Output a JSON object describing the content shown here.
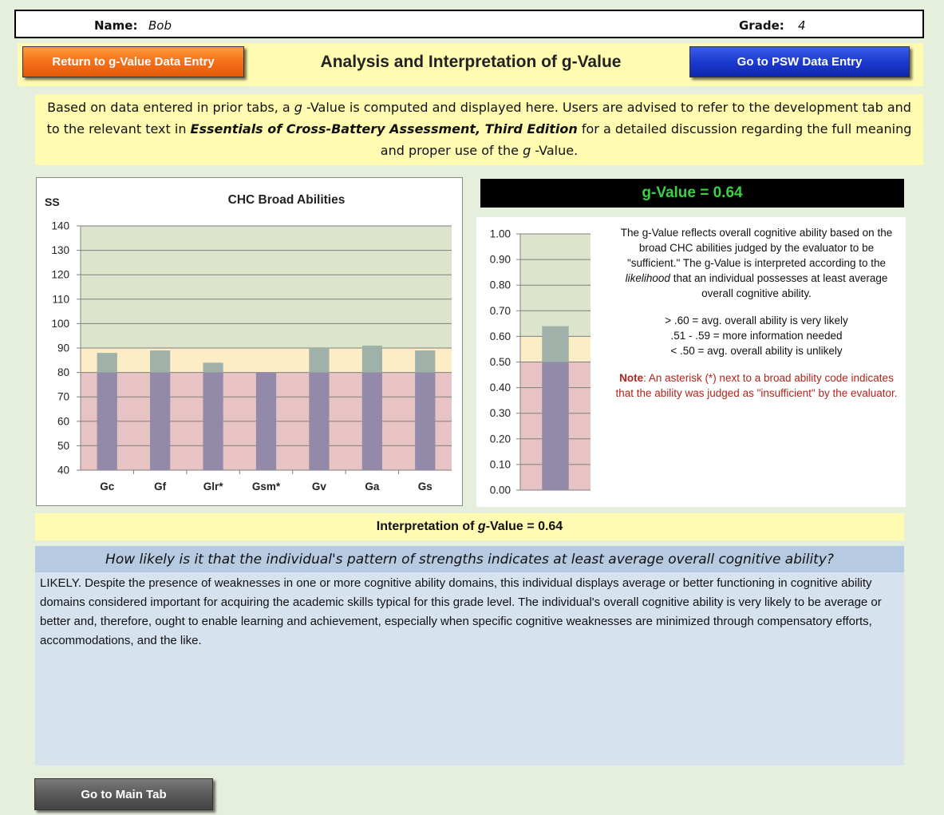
{
  "header": {
    "name_label": "Name:",
    "name_value": "Bob",
    "grade_label": "Grade:",
    "grade_value": "4"
  },
  "nav": {
    "return_button": "Return to g-Value Data Entry",
    "title": "Analysis and Interpretation of g-Value",
    "psw_button": "Go to PSW Data Entry",
    "main_button": "Go to Main Tab"
  },
  "intro": {
    "part1": "Based on data entered in prior tabs, a ",
    "g": "g",
    "part2": " -Value is computed and displayed here. Users are advised to refer to the development tab and to the relevant text in ",
    "book": "Essentials of Cross-Battery Assessment, Third Edition",
    "part3": " for a detailed discussion regarding the full meaning and proper use of the ",
    "part4": " -Value."
  },
  "gvalue": {
    "header": "g-Value = 0.64",
    "desc1": "The g-Value reflects overall cognitive ability based on the broad CHC abilities judged by the evaluator to be \"sufficient.\" The g-Value is interpreted according to the ",
    "desc_em": "likelihood",
    "desc2": " that an individual possesses at least average overall cognitive ability.",
    "rule1": "> .60 = avg. overall ability is very likely",
    "rule2": ".51 - .59 = more information needed",
    "rule3": "< .50 = avg. overall ability is unlikely",
    "note_label": "Note",
    "note_text": ": An asterisk (*) next to a broad ability code indicates that the ability was judged as \"insufficient\" by the evaluator."
  },
  "interpretation": {
    "label_pre": "Interpretation of ",
    "label_g": "g",
    "label_post": " -Value = ",
    "value": "0.64",
    "question": "How likely is it that the individual's pattern of strengths indicates at least average overall cognitive ability?",
    "result": "LIKELY. Despite the presence of weaknesses in one or more cognitive ability domains, this individual displays average or better functioning in cognitive ability domains considered important for acquiring the academic skills typical for this grade level.  The individual's overall cognitive ability is very likely to be average or better and, therefore, ought to enable learning and achievement, especially when specific cognitive weaknesses are minimized through compensatory efforts, accommodations, and the like."
  },
  "colors": {
    "band_high": "#dce5cb",
    "band_mid": "#fdedc7",
    "band_low": "#e8c3c3",
    "bar_upper": "#9fb1a8",
    "bar_lower": "#938aaa"
  },
  "chart_data": [
    {
      "type": "bar",
      "title": "CHC Broad Abilities",
      "ylabel": "SS",
      "categories": [
        "Gc",
        "Gf",
        "Glr*",
        "Gsm*",
        "Gv",
        "Ga",
        "Gs"
      ],
      "values": [
        88,
        89,
        84,
        80,
        90,
        91,
        89
      ],
      "ylim": [
        40,
        140
      ],
      "yticks": [
        "140",
        "130",
        "120",
        "110",
        "100",
        "90",
        "80",
        "70",
        "60",
        "50",
        "40"
      ],
      "bands": [
        {
          "from": 40,
          "to": 80,
          "color": "#e8c3c3"
        },
        {
          "from": 80,
          "to": 90,
          "color": "#fdedc7"
        },
        {
          "from": 90,
          "to": 140,
          "color": "#dce5cb"
        }
      ],
      "grid": true
    },
    {
      "type": "bar",
      "categories": [
        ""
      ],
      "values": [
        0.64
      ],
      "ylim": [
        0,
        1
      ],
      "yticks": [
        "1.00",
        "0.90",
        "0.80",
        "0.70",
        "0.60",
        "0.50",
        "0.40",
        "0.30",
        "0.20",
        "0.10",
        "0.00"
      ],
      "bands": [
        {
          "from": 0,
          "to": 0.5,
          "color": "#e8c3c3"
        },
        {
          "from": 0.5,
          "to": 0.6,
          "color": "#fdedc7"
        },
        {
          "from": 0.6,
          "to": 1.0,
          "color": "#dce5cb"
        }
      ],
      "grid": true
    }
  ]
}
